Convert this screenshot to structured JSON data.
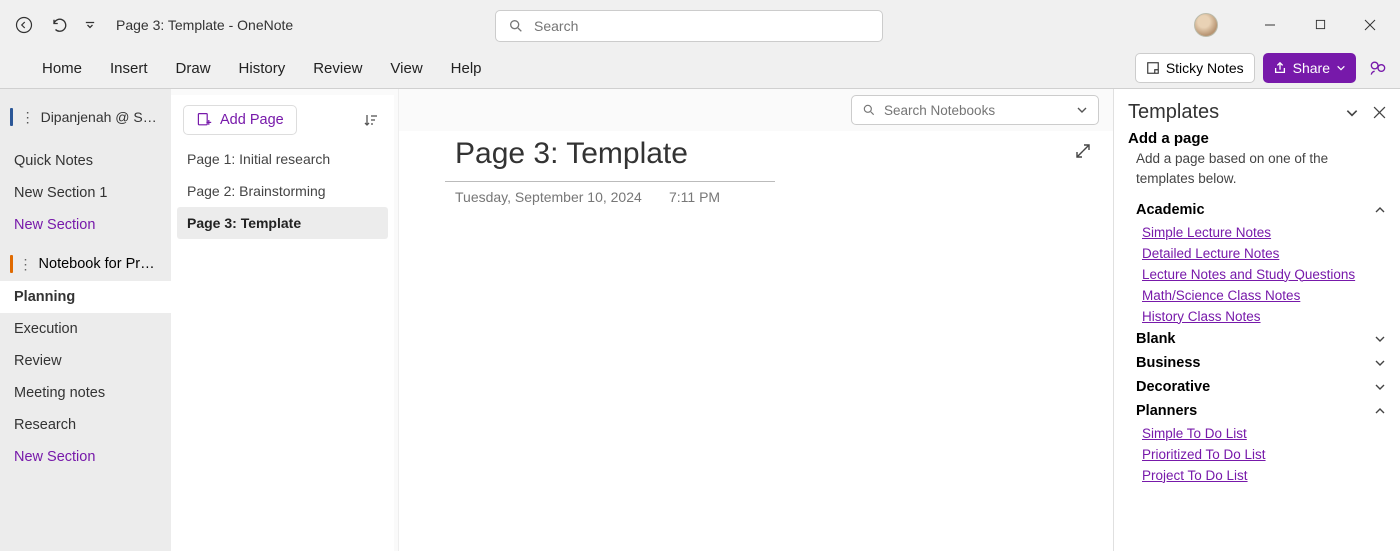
{
  "titlebar": {
    "title": "Page 3: Template  -  OneNote",
    "search_placeholder": "Search"
  },
  "menubar": {
    "items": [
      "Home",
      "Insert",
      "Draw",
      "History",
      "Review",
      "View",
      "Help"
    ],
    "sticky_label": "Sticky Notes",
    "share_label": "Share"
  },
  "sidebar": {
    "account": "Dipanjenah @ Spiral...",
    "items": [
      {
        "label": "Quick Notes",
        "style": "normal"
      },
      {
        "label": "New Section 1",
        "style": "normal"
      },
      {
        "label": "New Section",
        "style": "purple"
      }
    ],
    "project": "Notebook for Project A",
    "sections": [
      {
        "label": "Planning",
        "active": true
      },
      {
        "label": "Execution"
      },
      {
        "label": "Review"
      },
      {
        "label": "Meeting notes"
      },
      {
        "label": "Research"
      },
      {
        "label": "New Section",
        "style": "purple"
      }
    ]
  },
  "pages": {
    "add_label": "Add Page",
    "items": [
      {
        "label": "Page 1: Initial research"
      },
      {
        "label": "Page 2: Brainstorming"
      },
      {
        "label": "Page 3: Template",
        "active": true
      }
    ]
  },
  "canvas": {
    "search_nb_placeholder": "Search Notebooks",
    "title": "Page 3: Template",
    "date": "Tuesday, September 10, 2024",
    "time": "7:11 PM"
  },
  "templates": {
    "title": "Templates",
    "heading": "Add a page",
    "desc": "Add a page based on one of the templates below.",
    "categories": [
      {
        "name": "Academic",
        "expanded": true,
        "links": [
          "Simple Lecture Notes",
          "Detailed Lecture Notes",
          "Lecture Notes and Study Questions",
          "Math/Science Class Notes",
          "History Class Notes"
        ]
      },
      {
        "name": "Blank",
        "expanded": false
      },
      {
        "name": "Business",
        "expanded": false
      },
      {
        "name": "Decorative",
        "expanded": false
      },
      {
        "name": "Planners",
        "expanded": true,
        "links": [
          "Simple To Do List",
          "Prioritized To Do List",
          "Project To Do List"
        ]
      }
    ]
  }
}
